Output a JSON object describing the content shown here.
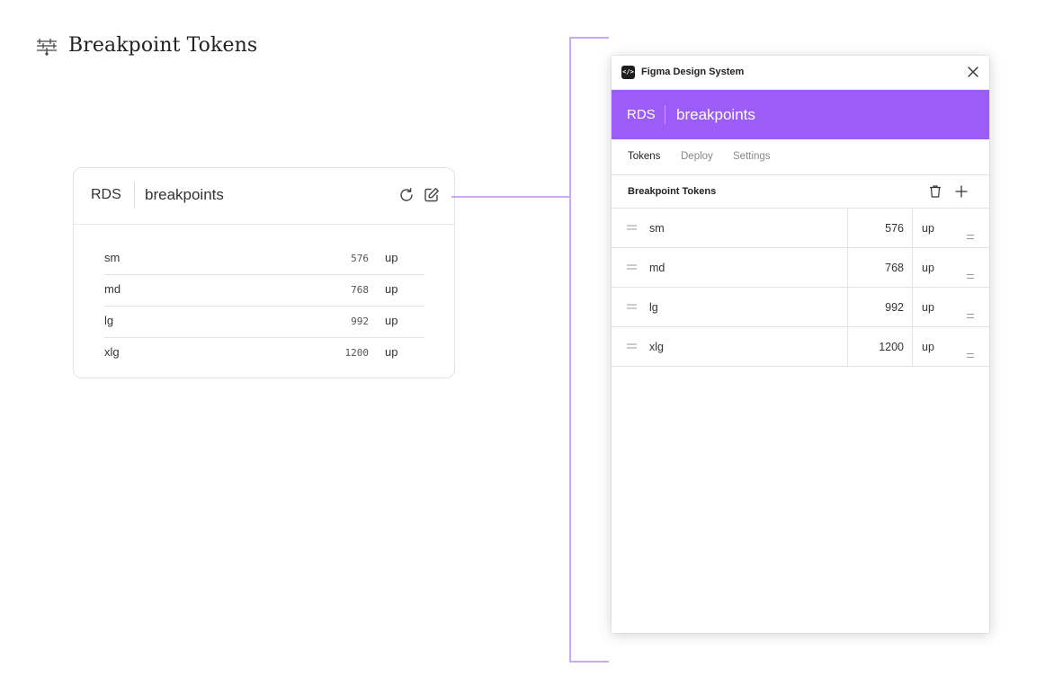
{
  "page": {
    "title": "Breakpoint Tokens"
  },
  "card": {
    "brand": "RDS",
    "token_set": "breakpoints",
    "rows": [
      {
        "name": "sm",
        "value": "576",
        "unit": "up"
      },
      {
        "name": "md",
        "value": "768",
        "unit": "up"
      },
      {
        "name": "lg",
        "value": "992",
        "unit": "up"
      },
      {
        "name": "xlg",
        "value": "1200",
        "unit": "up"
      }
    ]
  },
  "plugin": {
    "window_title": "Figma Design System",
    "logo_glyph": "</>",
    "header": {
      "brand": "RDS",
      "token_set": "breakpoints",
      "color": "#9b5cf7"
    },
    "tabs": [
      {
        "label": "Tokens",
        "active": true
      },
      {
        "label": "Deploy",
        "active": false
      },
      {
        "label": "Settings",
        "active": false
      }
    ],
    "section": {
      "label": "Breakpoint Tokens"
    },
    "rows": [
      {
        "name": "sm",
        "value": "576",
        "unit": "up"
      },
      {
        "name": "md",
        "value": "768",
        "unit": "up"
      },
      {
        "name": "lg",
        "value": "992",
        "unit": "up"
      },
      {
        "name": "xlg",
        "value": "1200",
        "unit": "up"
      }
    ]
  },
  "colors": {
    "accent": "#9b5cf7",
    "connector": "#c9a9f5"
  },
  "icons": [
    "sliders-icon",
    "refresh-icon",
    "edit-icon",
    "close-icon",
    "trash-icon",
    "plus-icon",
    "drag-handle-icon",
    "select-caret-icon"
  ]
}
